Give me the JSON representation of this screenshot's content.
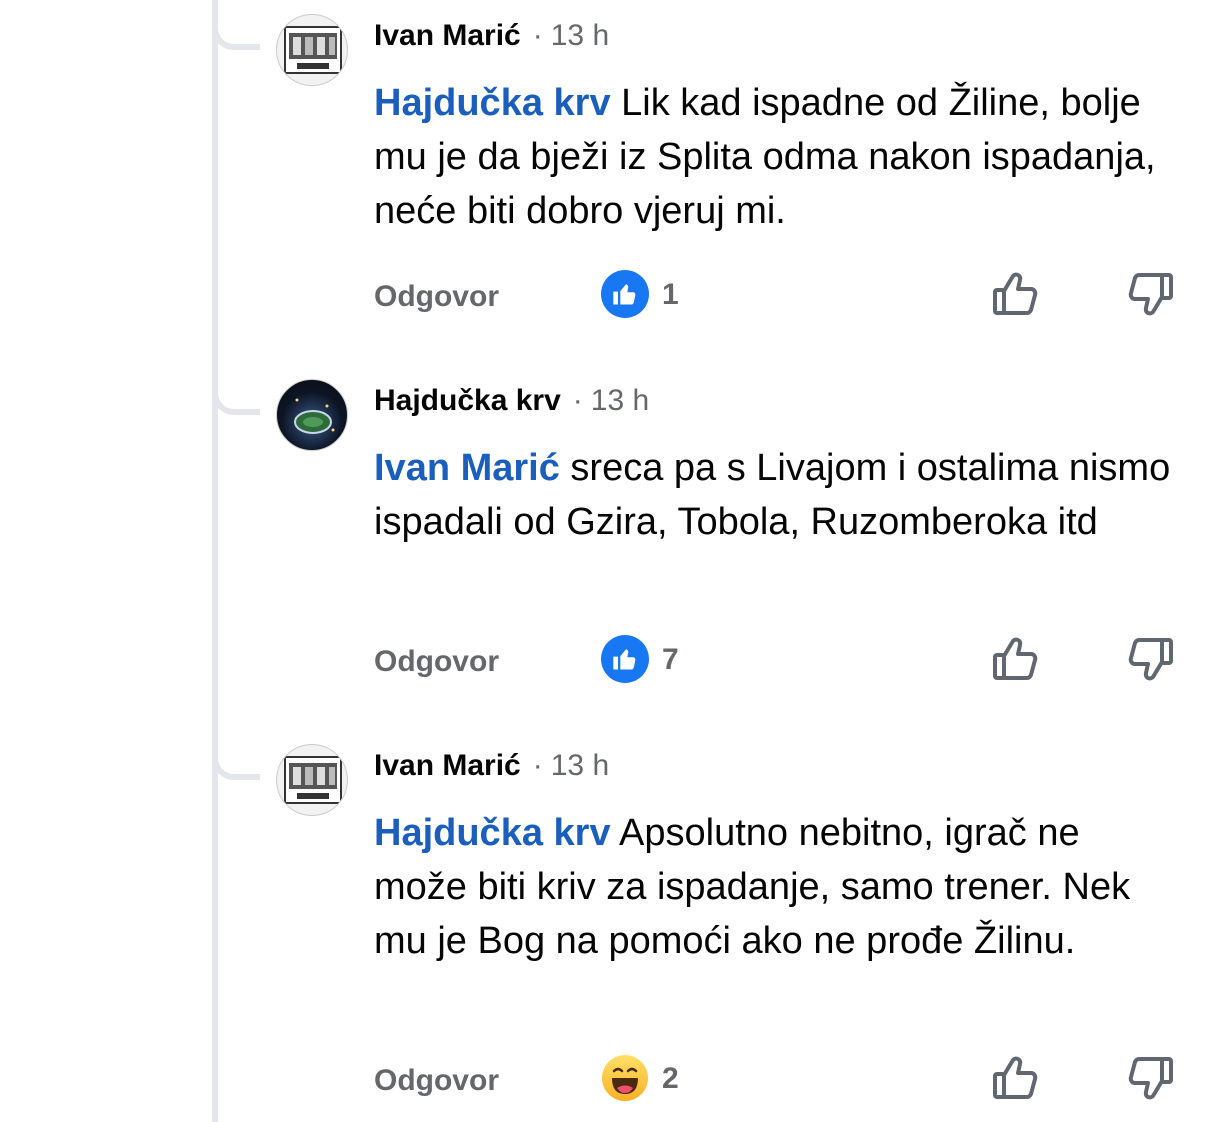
{
  "comments": [
    {
      "author": "Ivan Marić",
      "dot": "·",
      "time": "13 h",
      "mention": "Hajdučka krv",
      "text": " Lik kad ispadne od Žiline, bolje mu je da bježi iz Splita odma nakon ispadanja, neće biti dobro vjeruj mi.",
      "reply_label": "Odgovor",
      "reaction_type": "like",
      "reaction_count": "1"
    },
    {
      "author": "Hajdučka krv",
      "dot": "·",
      "time": "13 h",
      "mention": "Ivan Marić",
      "text": " sreca pa s Livajom i ostalima nismo ispadali od Gzira, Tobola, Ruzomberoka itd",
      "reply_label": "Odgovor",
      "reaction_type": "like",
      "reaction_count": "7"
    },
    {
      "author": "Ivan Marić",
      "dot": "·",
      "time": "13 h",
      "mention": "Hajdučka krv",
      "text": " Apsolutno nebitno, igrač ne može biti kriv za ispadanje, samo trener. Nek mu je Bog na pomoći ako ne prođe Žilinu.",
      "reply_label": "Odgovor",
      "reaction_type": "haha",
      "reaction_count": "2"
    }
  ],
  "colors": {
    "mention": "#1b5fbe",
    "like_badge": "#1877f2",
    "secondary_text": "#65676b",
    "thread_line": "#e4e6eb"
  },
  "icons": [
    "like-reaction-icon",
    "haha-reaction-icon",
    "thumbs-up-icon",
    "thumbs-down-icon"
  ]
}
